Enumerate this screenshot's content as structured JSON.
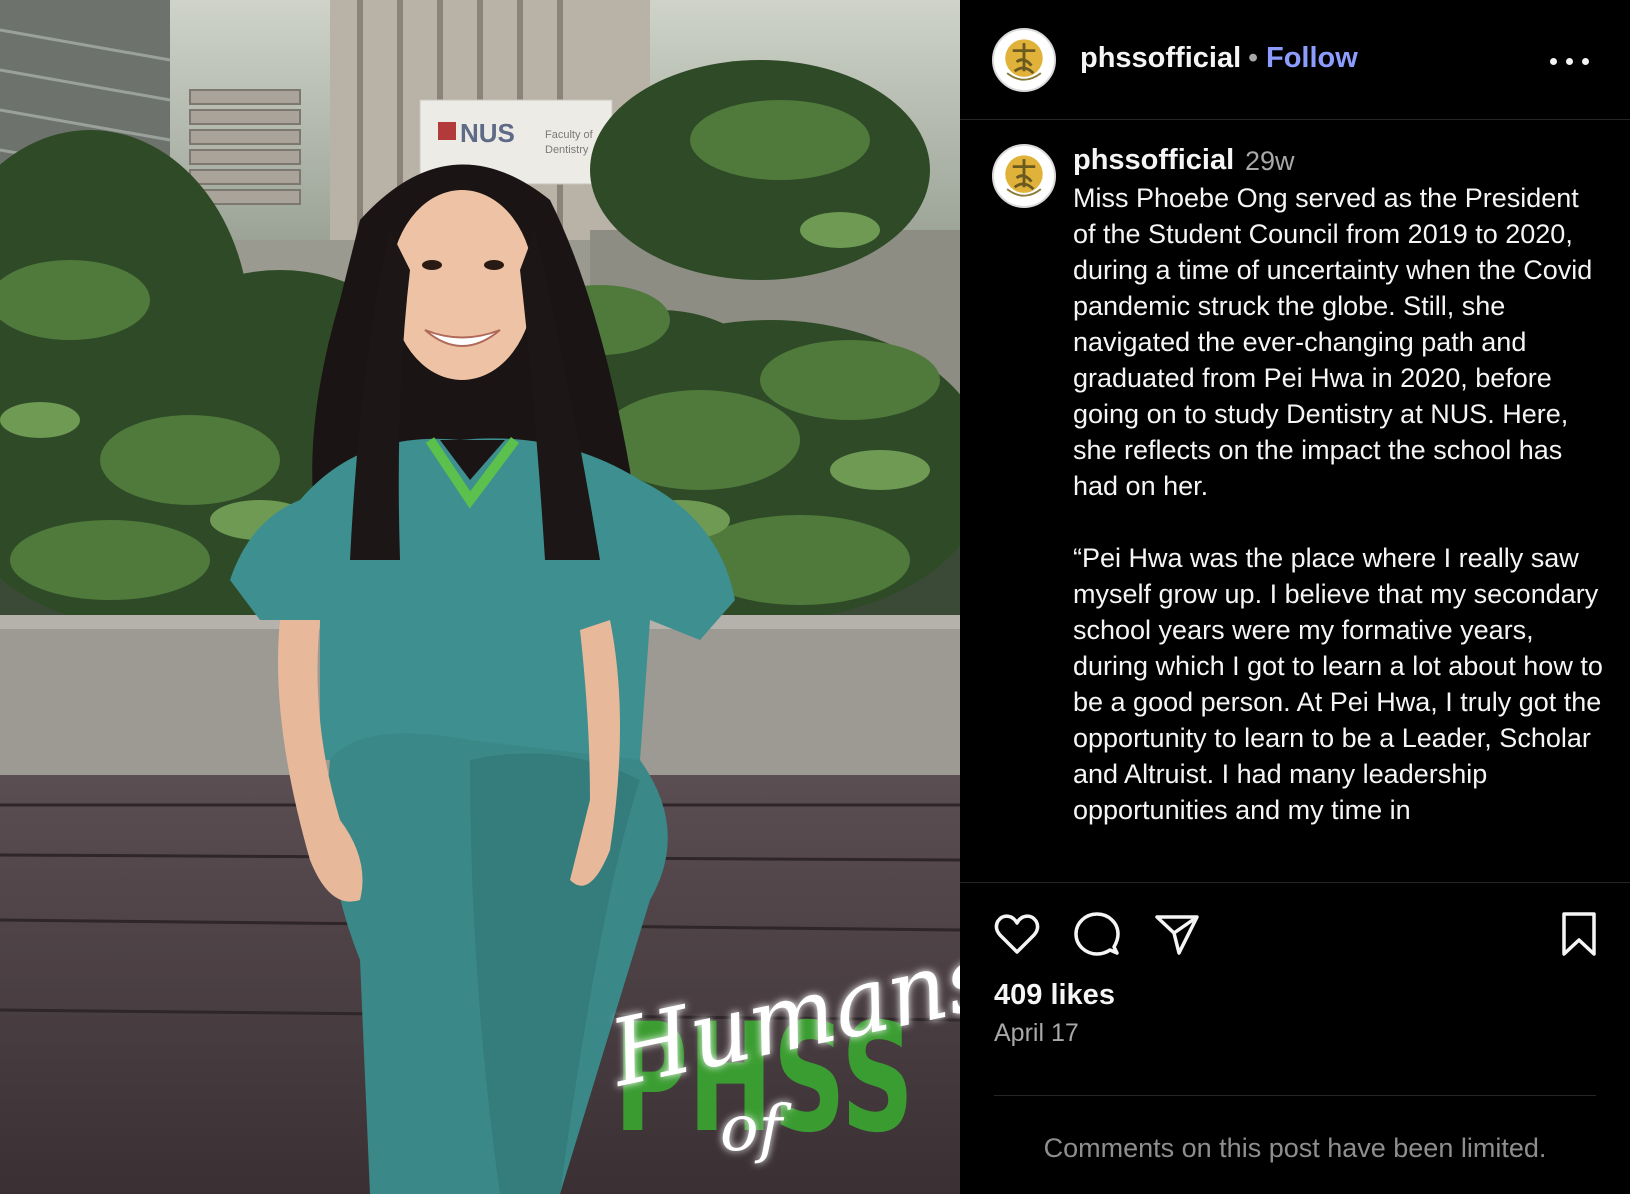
{
  "post": {
    "username": "phssofficial",
    "follow_label": "Follow",
    "separator": "•",
    "time_ago": "29w",
    "caption": "Miss Phoebe Ong served as the President of the Student Council from 2019 to 2020, during a time of uncertainty when the Covid pandemic struck the globe. Still, she navigated the ever-changing path and graduated from Pei Hwa in 2020, before going on to study Dentistry at NUS. Here, she reflects on the impact the school has had on her.\n\n“Pei Hwa was the place where I really saw myself grow up. I believe that my secondary school years were my formative years, during which I got to learn a lot about how to be a good person. At Pei Hwa, I truly got the opportunity to learn to be a Leader, Scholar and Altruist. I had many leadership opportunities and my time in",
    "likes": "409 likes",
    "date": "April 17",
    "comments_limited": "Comments on this post have been limited."
  },
  "photo": {
    "sign_line1": "NUS",
    "sign_line2": "Faculty of",
    "sign_line3": "Dentistry",
    "overlay_script": "Humans",
    "overlay_script2": "of",
    "overlay_block": "PHSS"
  },
  "icons": {
    "more": "more-options-icon",
    "like": "heart-icon",
    "comment": "comment-icon",
    "share": "share-icon",
    "save": "bookmark-icon",
    "avatar": "school-logo-avatar"
  },
  "colors": {
    "follow": "#8c9dff",
    "overlay_green": "#3aa830",
    "scrubs": "#3e8f8f"
  }
}
